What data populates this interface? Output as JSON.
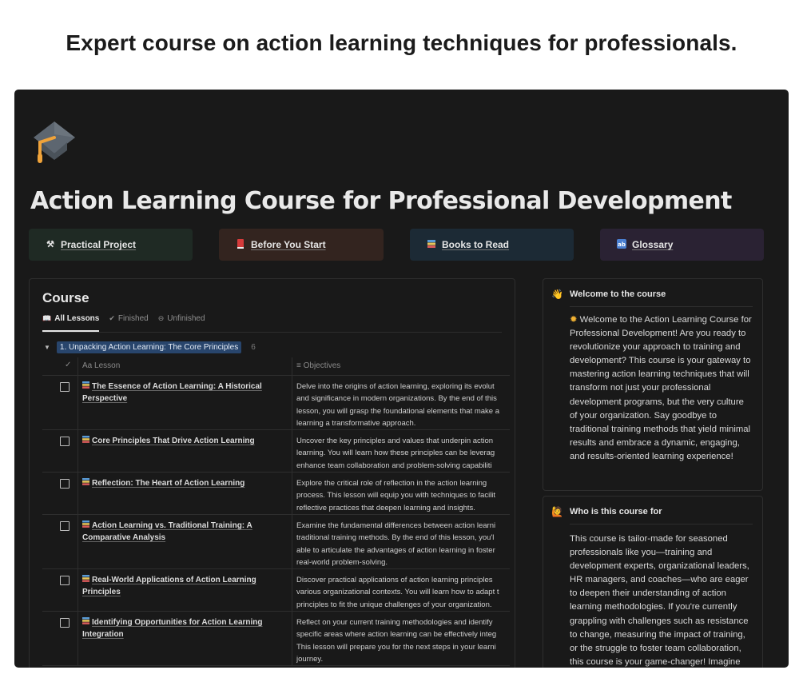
{
  "headline": "Expert course on action learning techniques for professionals.",
  "page": {
    "icon": "graduation-cap-icon",
    "title": "Action Learning Course for Professional Development"
  },
  "nav_cards": [
    {
      "label": "Practical Project",
      "icon": "tools-icon",
      "bg": "#1f2a24"
    },
    {
      "label": "Before You Start",
      "icon": "red-book-icon",
      "bg": "#33241f"
    },
    {
      "label": "Books to Read",
      "icon": "books-icon",
      "bg": "#1c2a35"
    },
    {
      "label": "Glossary",
      "icon": "abcd-icon",
      "bg": "#2a2233"
    }
  ],
  "course": {
    "title": "Course",
    "tabs": [
      {
        "label": "All Lessons",
        "icon": "open-book-icon",
        "active": true
      },
      {
        "label": "Finished",
        "icon": "check-circle-icon",
        "active": false
      },
      {
        "label": "Unfinished",
        "icon": "minus-circle-icon",
        "active": false
      }
    ],
    "group": {
      "name": "1. Unpacking Action Learning: The Core Principles",
      "count": "6"
    },
    "columns": {
      "lesson": "Lesson",
      "lesson_prefix": "Aa",
      "objectives": "Objectives"
    },
    "rows": [
      {
        "lesson": "The Essence of Action Learning: A Historical Perspective",
        "objectives": [
          "Delve into the origins of action learning, exploring its evolut",
          "and significance in modern organizations. By the end of this",
          "lesson, you will grasp the foundational elements that make a",
          "learning a transformative approach."
        ]
      },
      {
        "lesson": "Core Principles That Drive Action Learning",
        "objectives": [
          "Uncover the key principles and values that underpin action",
          "learning. You will learn how these principles can be leverag",
          "enhance team collaboration and problem-solving capabiliti"
        ]
      },
      {
        "lesson": "Reflection: The Heart of Action Learning",
        "objectives": [
          "Explore the critical role of reflection in the action learning",
          "process. This lesson will equip you with techniques to facilit",
          "reflective practices that deepen learning and insights."
        ]
      },
      {
        "lesson": "Action Learning vs. Traditional Training: A Comparative Analysis",
        "objectives": [
          "Examine the fundamental differences between action learni",
          "traditional training methods. By the end of this lesson, you'l",
          "able to articulate the advantages of action learning in foster",
          "real-world problem-solving."
        ]
      },
      {
        "lesson": "Real-World Applications of Action Learning Principles",
        "objectives": [
          "Discover practical applications of action learning principles",
          "various organizational contexts. You will learn how to adapt t",
          "principles to fit the unique challenges of your organization."
        ]
      },
      {
        "lesson": "Identifying Opportunities for Action Learning Integration",
        "objectives": [
          "Reflect on your current training methodologies and identify",
          "specific areas where action learning can be effectively integ",
          "This lesson will prepare you for the next steps in your learni",
          "journey."
        ]
      }
    ]
  },
  "sidebar": {
    "welcome": {
      "icon": "waving-hand-icon",
      "title": "Welcome to the course",
      "body_icon": "sun-icon",
      "body": "Welcome to the Action Learning Course for Professional Development! Are you ready to revolutionize your approach to training and development? This course is your gateway to mastering action learning techniques that will transform not just your professional development programs, but the very culture of your organization. Say goodbye to traditional training methods that yield minimal results and embrace a dynamic, engaging, and results-oriented learning experience!"
    },
    "audience": {
      "icon": "person-raising-hand-icon",
      "title": "Who is this course for",
      "body": "This course is tailor-made for seasoned professionals like you—training and development experts, organizational leaders, HR managers, and coaches—who are eager to deepen their understanding of action learning methodologies. If you're currently grappling with challenges such as resistance to change, measuring the impact of training, or the struggle to foster team collaboration, this course is your game-changer! Imagine"
    }
  }
}
